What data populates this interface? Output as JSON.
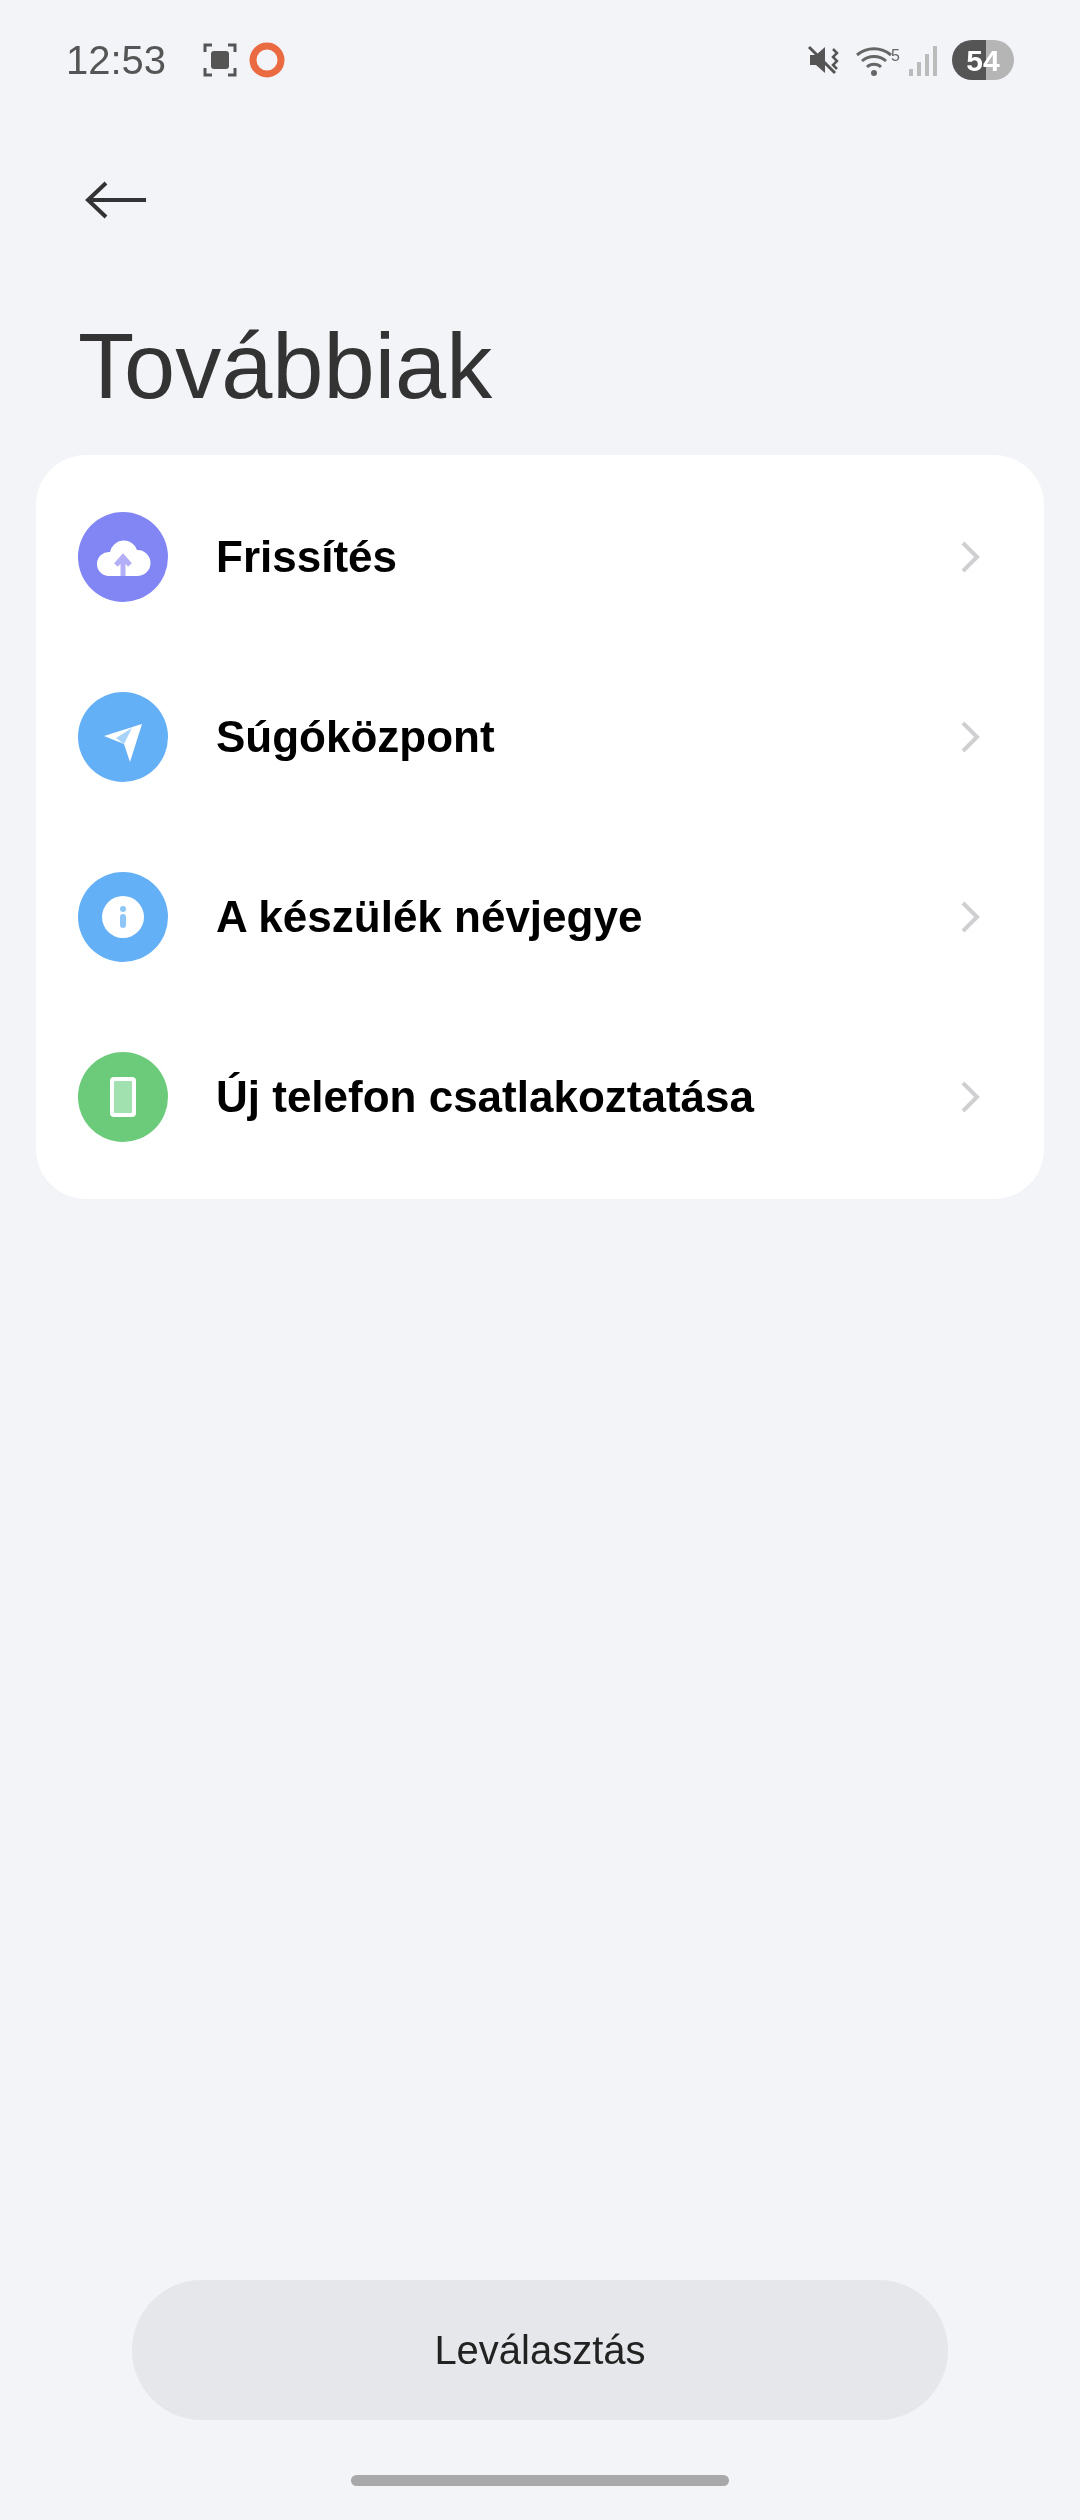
{
  "status_bar": {
    "time": "12:53",
    "wifi_badge": "5",
    "battery": "54"
  },
  "title": "Továbbiak",
  "items": [
    {
      "label": "Frissítés",
      "kind": "cloud",
      "color": "#8286f5"
    },
    {
      "label": "Súgóközpont",
      "kind": "send",
      "color": "#64b0f7"
    },
    {
      "label": "A készülék névjegye",
      "kind": "info",
      "color": "#64b0f7"
    },
    {
      "label": "Új telefon csatlakoztatása",
      "kind": "phone",
      "color": "#6ccb7a"
    }
  ],
  "button": "Leválasztás"
}
